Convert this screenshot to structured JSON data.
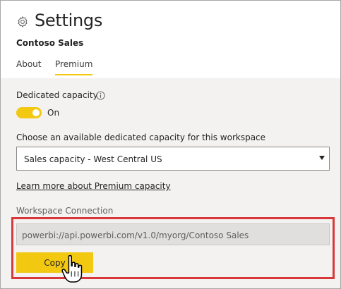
{
  "header": {
    "title": "Settings",
    "workspace_name": "Contoso Sales",
    "gear_icon": "gear-icon",
    "tabs": [
      {
        "label": "About",
        "selected": false
      },
      {
        "label": "Premium",
        "selected": true
      }
    ]
  },
  "premium": {
    "dedicated_capacity": {
      "label": "Dedicated capacity",
      "info_icon": "info-icon",
      "toggle_state": "On",
      "enabled": true
    },
    "capacity_select": {
      "label": "Choose an available dedicated capacity for this workspace",
      "selected_value": "Sales capacity - West Central US",
      "arrow_icon": "caret-down-icon"
    },
    "learn_more_link": "Learn more about Premium capacity",
    "workspace_connection": {
      "label": "Workspace Connection",
      "value": "powerbi://api.powerbi.com/v1.0/myorg/Contoso Sales",
      "copy_button": "Copy"
    }
  },
  "colors": {
    "accent_yellow": "#f2c811",
    "highlight_red": "#d9383a",
    "content_background": "#f3f2f1",
    "readonly_field": "#e1dfdd",
    "text": "#252423"
  },
  "cursor_icon": "hand-pointer-icon"
}
